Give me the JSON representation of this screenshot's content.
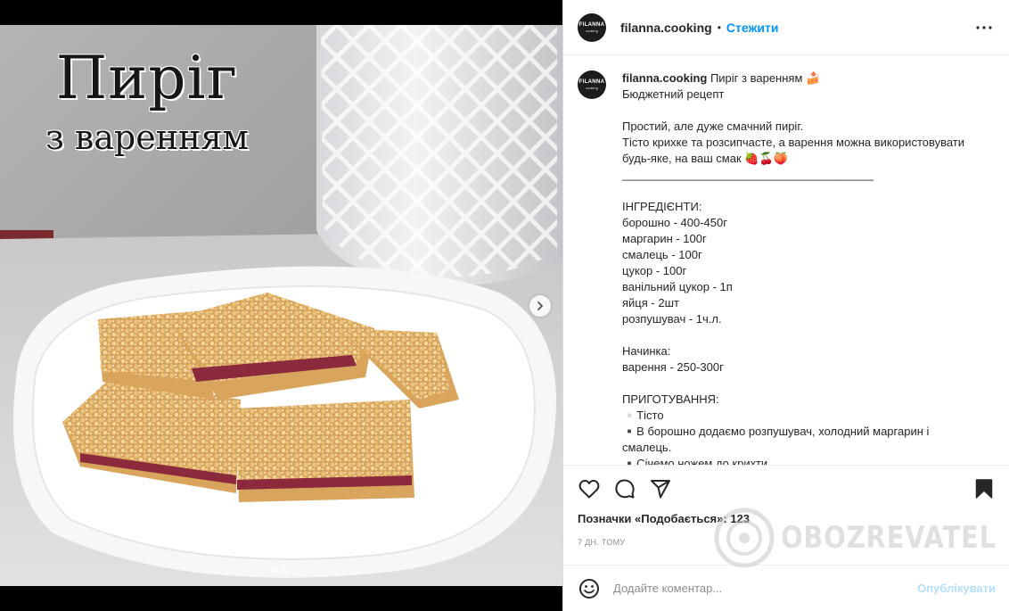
{
  "media": {
    "overlay_title_line1": "Пиріг",
    "overlay_title_line2": "з варенням",
    "next_icon": "chevron-right-icon",
    "dots_total": 2,
    "dots_active": 1
  },
  "header": {
    "avatar_line1": "FILANNA",
    "avatar_line2": "cooking",
    "username": "filanna.cooking",
    "separator": "•",
    "follow_label": "Стежити",
    "more_icon": "more-options-icon"
  },
  "caption": {
    "username": "filanna.cooking",
    "text": " Пиріг з варенням 🍰\nБюджетний рецепт\n\nПростий, але дуже смачний пиріг.\nТісто крихке та розсипчасте, а варення можна використовувати будь-яке, на ваш смак 🍓🍒🍑\n_______________________________________\n\nІНГРЕДІЄНТИ:\nборошно - 400-450г\nмаргарин - 100г\nсмалець - 100г\nцукор - 100г\nванільний цукор - 1п\nяйця - 2шт\nрозпушувач - 1ч.л.\n\nНачинка:\nварення - 250-300г\n\nПРИГОТУВАННЯ:\n▫️Тісто\n▪️В борошно додаємо розпушувач, холодний маргарин і смалець.\n▪️Січемо ножем до крихти."
  },
  "actions": {
    "like_icon": "heart-icon",
    "comment_icon": "comment-icon",
    "share_icon": "send-icon",
    "save_icon": "bookmark-icon",
    "likes_label": "Позначки «Подобається»:",
    "likes_count": "123",
    "time": "7 дн. тому"
  },
  "comment": {
    "emoji_icon": "emoji-icon",
    "placeholder": "Додайте коментар...",
    "publish_label": "Опублікувати"
  },
  "watermark": {
    "text": "OBOZREVATEL"
  },
  "colors": {
    "accent": "#0095f6",
    "publish_disabled": "#b2dffc",
    "text": "#262626",
    "muted": "#8e8e8e"
  }
}
